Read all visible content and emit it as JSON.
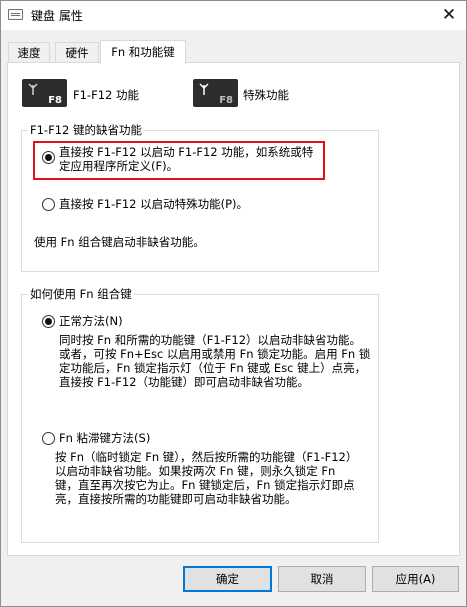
{
  "window": {
    "title": "键盘 属性",
    "close_glyph": "✕"
  },
  "tabs": [
    {
      "label": "速度",
      "active": false
    },
    {
      "label": "硬件",
      "active": false
    },
    {
      "label": "Fn 和功能键",
      "active": true
    }
  ],
  "legend": {
    "fkeys_icon_text": "F8",
    "fkeys_label": "F1-F12 功能",
    "special_icon_text": "F8",
    "special_label": "特殊功能"
  },
  "default_group": {
    "title": "F1-F12 键的缺省功能",
    "option1_line1": "直接按 F1-F12 以启动 F1-F12 功能，如系统或特",
    "option1_line2": "定应用程序所定义(F)。",
    "option1_checked": true,
    "option2": "直接按 F1-F12 以启动特殊功能(P)。",
    "option2_checked": false,
    "note": "使用 Fn 组合键启动非缺省功能。"
  },
  "fn_group": {
    "title": "如何使用 Fn 组合键",
    "normal_label": "正常方法(N)",
    "normal_checked": true,
    "normal_desc": [
      "同时按 Fn 和所需的功能键（F1-F12）以启动非缺省功能。",
      "或者，可按 Fn+Esc 以启用或禁用 Fn 锁定功能。启用 Fn 锁",
      "定功能后，Fn 锁定指示灯（位于 Fn 键或 Esc 键上）点亮，",
      "直接按 F1-F12（功能键）即可启动非缺省功能。"
    ],
    "sticky_label": "Fn 粘滞键方法(S)",
    "sticky_checked": false,
    "sticky_desc": [
      "按 Fn（临时锁定 Fn 键），然后按所需的功能键（F1-F12）",
      "以启动非缺省功能。如果按两次 Fn 键，则永久锁定 Fn",
      "键，直至再次按它为止。Fn 键锁定后，Fn 锁定指示灯即点",
      "亮，直接按所需的功能键即可启动非缺省功能。"
    ]
  },
  "buttons": {
    "ok": "确定",
    "cancel": "取消",
    "apply": "应用(A)"
  },
  "colors": {
    "highlight": "#e3101a",
    "default_button_border": "#0078d7"
  }
}
